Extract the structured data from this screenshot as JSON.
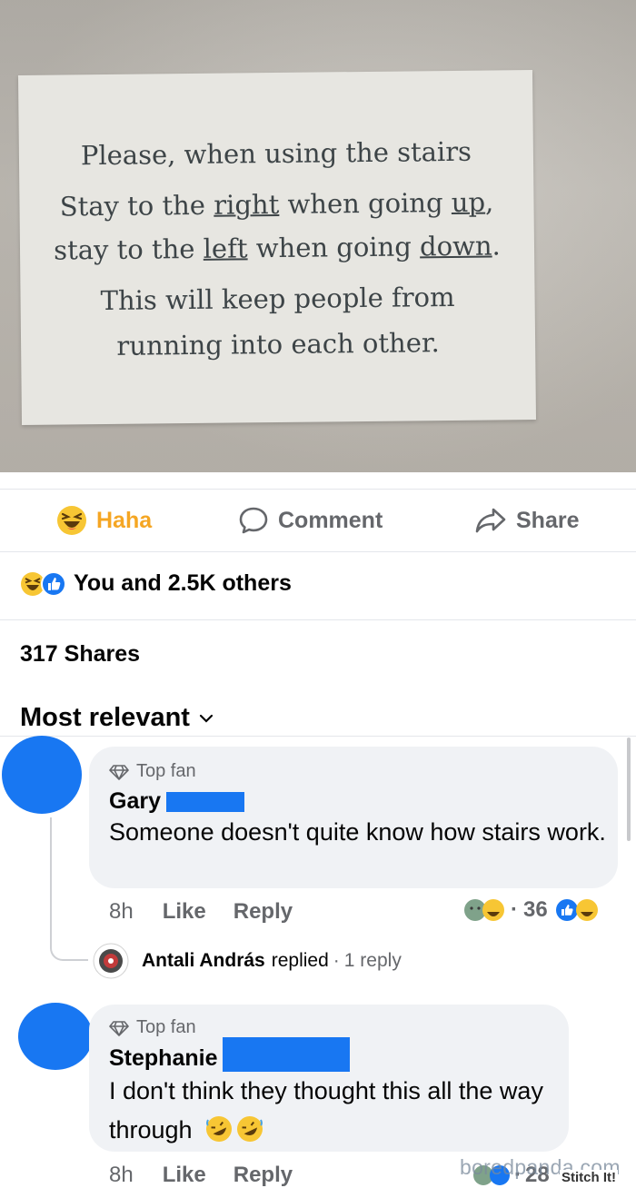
{
  "photo": {
    "sign_lines": [
      [
        "Please, when using the stairs"
      ],
      [
        "Stay to the ",
        "right",
        " when going ",
        "up",
        ","
      ],
      [
        "stay to the ",
        "left",
        " when going ",
        "down",
        "."
      ],
      [
        "This will keep people from"
      ],
      [
        "running into each other."
      ]
    ]
  },
  "action_bar": {
    "haha_label": "Haha",
    "comment_label": "Comment",
    "share_label": "Share"
  },
  "reactions_summary": "You and 2.5K others",
  "shares_count": "317 Shares",
  "sort_label": "Most relevant",
  "comments": [
    {
      "badge": "Top fan",
      "author": "Gary",
      "text": "Someone doesn't quite know how stairs work.",
      "time": "8h",
      "like_label": "Like",
      "reply_label": "Reply",
      "reaction_count": "36"
    },
    {
      "badge": "Top fan",
      "author": "Stephanie",
      "text": "I don't think they thought this all the way through",
      "time": "8h",
      "like_label": "Like",
      "reply_label": "Reply",
      "reaction_count": "28"
    }
  ],
  "reply_summary": {
    "name": "Antali András",
    "action": "replied",
    "count": "1 reply"
  },
  "watermark": "boredpanda.com",
  "stitch_label": "Stitch It!",
  "colors": {
    "facebook_blue": "#1877f2",
    "haha_yellow": "#f5a623",
    "secondary_text": "#65676b",
    "bubble_bg": "#f0f2f5"
  }
}
